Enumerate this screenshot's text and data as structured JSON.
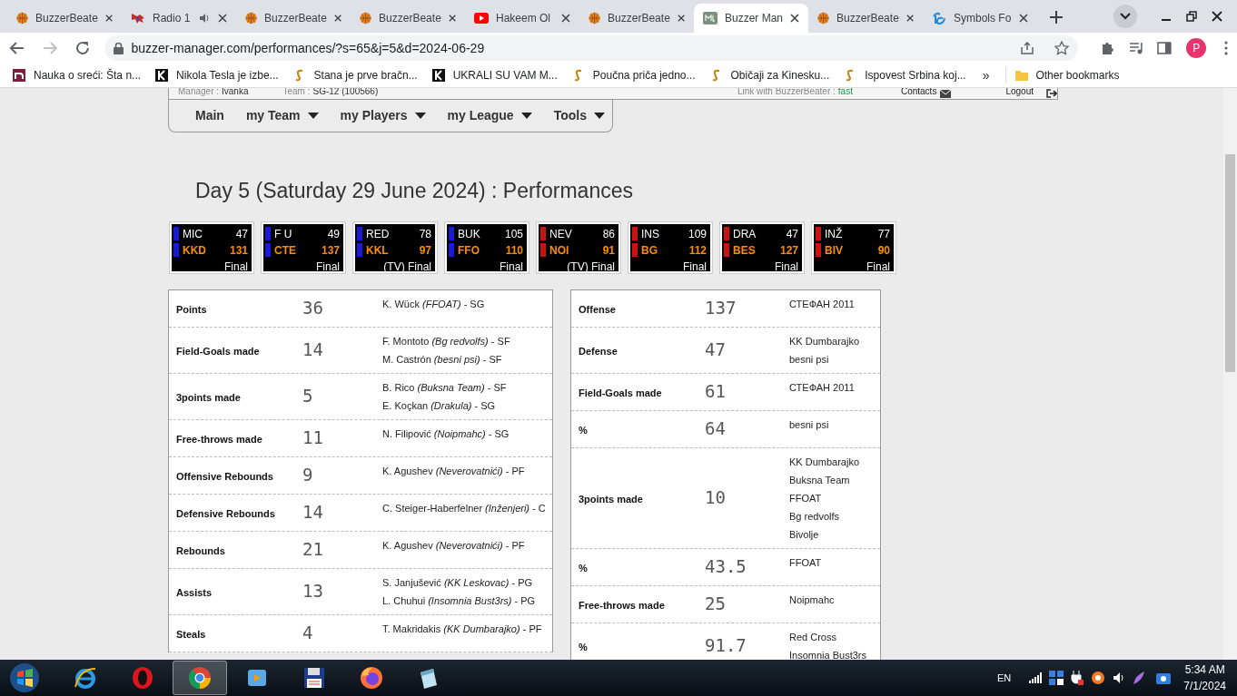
{
  "browser": {
    "tabs": [
      {
        "title": "BuzzerBeate",
        "kind": "ball",
        "selected": false
      },
      {
        "title": "Radio 1",
        "kind": "radio",
        "selected": false
      },
      {
        "title": "BuzzerBeate",
        "kind": "ball",
        "selected": false
      },
      {
        "title": "BuzzerBeate",
        "kind": "ball",
        "selected": false
      },
      {
        "title": "Hakeem Ol",
        "kind": "video",
        "selected": false
      },
      {
        "title": "BuzzerBeate",
        "kind": "ball",
        "selected": false
      },
      {
        "title": "Buzzer Man",
        "kind": "bm",
        "selected": true
      },
      {
        "title": "BuzzerBeate",
        "kind": "ball",
        "selected": false
      },
      {
        "title": "Symbols Fo",
        "kind": "ig",
        "selected": false
      }
    ],
    "url": "buzzer-manager.com/performances/?s=65&j=5&d=2024-06-29",
    "profile_initial": "P",
    "bookmarks": [
      {
        "title": "Nauka o sreći: Šta n...",
        "kind": "n"
      },
      {
        "title": "Nikola Tesla je izbe...",
        "kind": "k"
      },
      {
        "title": "Stana je prve bračn...",
        "kind": "s"
      },
      {
        "title": "UKRALI SU VAM M...",
        "kind": "k"
      },
      {
        "title": "Poučna priča jedno...",
        "kind": "s"
      },
      {
        "title": "Običaji za Kinesku...",
        "kind": "s"
      },
      {
        "title": "Ispovest Srbina koj...",
        "kind": "s"
      }
    ],
    "bookmarks_overflow": "»",
    "other_bookmarks": "Other bookmarks"
  },
  "header": {
    "manager_label": "Manager :",
    "manager": "Ivanka",
    "team_label": "Team :",
    "team": "SG-12 (100566)",
    "link_label": "Link with BuzzerBeater :",
    "link_value": "fast",
    "contacts": "Contacts",
    "logout": "Logout"
  },
  "nav": [
    {
      "label": "Main",
      "dropdown": false
    },
    {
      "label": "my Team",
      "dropdown": true
    },
    {
      "label": "my Players",
      "dropdown": true
    },
    {
      "label": "my League",
      "dropdown": true
    },
    {
      "label": "Tools",
      "dropdown": true
    }
  ],
  "title": "Day 5 (Saturday 29 June 2024) : Performances",
  "games": [
    {
      "away": "MIC",
      "away_score": "47",
      "home": "KKD",
      "home_score": "131",
      "status": "Final",
      "color": "#1a1ad6"
    },
    {
      "away": "F U",
      "away_score": "49",
      "home": "CTE",
      "home_score": "137",
      "status": "Final",
      "color": "#1a1ad6"
    },
    {
      "away": "RED",
      "away_score": "78",
      "home": "KKL",
      "home_score": "97",
      "status": "(TV) Final",
      "color": "#1a1ad6"
    },
    {
      "away": "BUK",
      "away_score": "105",
      "home": "FFO",
      "home_score": "110",
      "status": "Final",
      "color": "#1a1ad6"
    },
    {
      "away": "NEV",
      "away_score": "86",
      "home": "NOI",
      "home_score": "91",
      "status": "(TV) Final",
      "color": "#cc1111"
    },
    {
      "away": "INS",
      "away_score": "109",
      "home": "BG",
      "home_score": "112",
      "status": "Final",
      "color": "#cc1111"
    },
    {
      "away": "DRA",
      "away_score": "47",
      "home": "BES",
      "home_score": "127",
      "status": "Final",
      "color": "#cc1111"
    },
    {
      "away": "INŽ",
      "away_score": "77",
      "home": "BIV",
      "home_score": "90",
      "status": "Final",
      "color": "#cc1111"
    }
  ],
  "player_records": [
    {
      "category": "Points",
      "value": "36",
      "holders": [
        "K. Wück *(FFOAT)* - SG"
      ]
    },
    {
      "category": "Field-Goals made",
      "value": "14",
      "holders": [
        "F. Montoto *(Bg redvolfs)* - SF",
        "M. Castrón *(besni psi)* - SF"
      ]
    },
    {
      "category": "3points made",
      "value": "5",
      "holders": [
        "B. Rico *(Buksna Team)* - SF",
        "E. Koçkan *(Drakula)* - SG"
      ]
    },
    {
      "category": "Free-throws made",
      "value": "11",
      "holders": [
        "N. Filipović *(Noipmahc)* - SG"
      ]
    },
    {
      "category": "Offensive Rebounds",
      "value": "9",
      "holders": [
        "K. Agushev *(Neverovatnići)* - PF"
      ]
    },
    {
      "category": "Defensive Rebounds",
      "value": "14",
      "holders": [
        "C. Steiger-Haberfelner *(Inženjeri)* - C"
      ]
    },
    {
      "category": "Rebounds",
      "value": "21",
      "holders": [
        "K. Agushev *(Neverovatnići)* - PF"
      ]
    },
    {
      "category": "Assists",
      "value": "13",
      "holders": [
        "S. Janjušević *(KK Leskovac)* - PG",
        "L. Chuhui *(Insomnia Bust3rs)* - PG"
      ]
    },
    {
      "category": "Steals",
      "value": "4",
      "holders": [
        "T. Makridakis *(KK Dumbarajko)* - PF"
      ]
    }
  ],
  "team_records": [
    {
      "category": "Offense",
      "value": "137",
      "holders": [
        "СТЕФАН 2011"
      ]
    },
    {
      "category": "Defense",
      "value": "47",
      "holders": [
        "KK Dumbarajko",
        "besni psi"
      ]
    },
    {
      "category": "Field-Goals made",
      "value": "61",
      "holders": [
        "СТЕФАН 2011"
      ]
    },
    {
      "category": "%",
      "value": "64",
      "holders": [
        "besni psi"
      ]
    },
    {
      "category": "3points made",
      "value": "10",
      "holders": [
        "KK Dumbarajko",
        "Buksna Team",
        "FFOAT",
        "Bg redvolfs",
        "Bivolje"
      ]
    },
    {
      "category": "%",
      "value": "43.5",
      "holders": [
        "FFOAT"
      ]
    },
    {
      "category": "Free-throws made",
      "value": "25",
      "holders": [
        "Noipmahc"
      ]
    },
    {
      "category": "%",
      "value": "91.7",
      "holders": [
        "Red Cross",
        "Insomnia Bust3rs"
      ]
    }
  ],
  "taskbar": {
    "apps": [
      {
        "kind": "ie",
        "selected": false
      },
      {
        "kind": "opera",
        "selected": false
      },
      {
        "kind": "chrome",
        "selected": true
      },
      {
        "kind": "media",
        "selected": false
      },
      {
        "kind": "floppy",
        "selected": false
      },
      {
        "kind": "firefox",
        "selected": false
      },
      {
        "kind": "notes",
        "selected": false
      }
    ],
    "language": "EN",
    "time": "5:34 AM",
    "date": "7/1/2024"
  }
}
